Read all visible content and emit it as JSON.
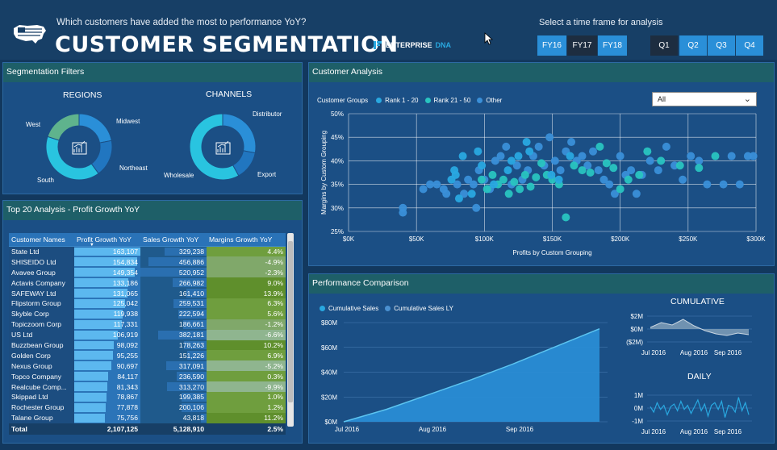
{
  "header": {
    "question": "Which customers have added the most to performance YoY?",
    "title": "CUSTOMER SEGMENTATION",
    "brand_part1": "ENTERPRISE",
    "brand_part2": "DNA",
    "timeframe_label": "Select a time frame for analysis",
    "fiscal_years": [
      {
        "label": "FY16",
        "selected": false
      },
      {
        "label": "FY17",
        "selected": true
      },
      {
        "label": "FY18",
        "selected": false
      }
    ],
    "quarters": [
      {
        "label": "Q1",
        "selected": true
      },
      {
        "label": "Q2",
        "selected": false
      },
      {
        "label": "Q3",
        "selected": false
      },
      {
        "label": "Q4",
        "selected": false
      }
    ]
  },
  "colors": {
    "dark_teal": "#1e5f68",
    "cyan": "#29c4e0",
    "mid_blue": "#2a8fd8",
    "green": "#5fb38d",
    "light_blue": "#48a6e6"
  },
  "segmentation": {
    "title": "Segmentation Filters",
    "regions": {
      "title": "REGIONS",
      "labels": [
        "Midwest",
        "Northeast",
        "South",
        "West"
      ],
      "values": [
        0.22,
        0.18,
        0.4,
        0.2
      ]
    },
    "channels": {
      "title": "CHANNELS",
      "labels": [
        "Distributor",
        "Export",
        "Wholesale"
      ],
      "values": [
        0.28,
        0.14,
        0.58
      ]
    }
  },
  "top20": {
    "title": "Top 20 Analysis - Profit Growth YoY",
    "columns": [
      "Customer Names",
      "Profit Growth YoY",
      "Sales Growth YoY",
      "Margins Growth YoY"
    ],
    "rows": [
      [
        "State Ltd",
        "163,107",
        "329,238",
        "4.4%"
      ],
      [
        "SHISEIDO Ltd",
        "154,834",
        "456,886",
        "-4.9%"
      ],
      [
        "Avavee Group",
        "149,354",
        "520,952",
        "-2.3%"
      ],
      [
        "Actavis Company",
        "133,186",
        "266,982",
        "9.0%"
      ],
      [
        "SAFEWAY Ltd",
        "131,065",
        "161,410",
        "13.9%"
      ],
      [
        "Flipstorm Group",
        "125,042",
        "259,531",
        "6.3%"
      ],
      [
        "Skyble Corp",
        "119,938",
        "222,594",
        "5.6%"
      ],
      [
        "Topiczoom Corp",
        "117,331",
        "186,661",
        "-1.2%"
      ],
      [
        "US Ltd",
        "106,919",
        "382,181",
        "-6.6%"
      ],
      [
        "Buzzbean Group",
        "98,092",
        "178,263",
        "10.2%"
      ],
      [
        "Golden Corp",
        "95,255",
        "151,226",
        "6.9%"
      ],
      [
        "Nexus Group",
        "90,697",
        "317,091",
        "-5.2%"
      ],
      [
        "Topco Company",
        "84,117",
        "236,590",
        "0.3%"
      ],
      [
        "Realcube Comp...",
        "81,343",
        "313,270",
        "-9.9%"
      ],
      [
        "Skippad Ltd",
        "78,867",
        "199,385",
        "1.0%"
      ],
      [
        "Rochester Group",
        "77,878",
        "200,106",
        "1.2%"
      ],
      [
        "Talane Group",
        "75,756",
        "43,818",
        "11.2%"
      ]
    ],
    "total": [
      "Total",
      "2,107,125",
      "5,128,910",
      "2.5%"
    ]
  },
  "customer_analysis": {
    "title": "Customer Analysis",
    "legend_title": "Customer Groups",
    "legend": [
      {
        "label": "Rank 1 - 20",
        "color": "#29a8e0"
      },
      {
        "label": "Rank 21 - 50",
        "color": "#29c4c0"
      },
      {
        "label": "Other",
        "color": "#3a8fd8"
      }
    ],
    "dropdown": "All"
  },
  "performance": {
    "title": "Performance Comparison",
    "legend": [
      {
        "label": "Cumulative Sales",
        "color": "#29a8e0"
      },
      {
        "label": "Cumulative Sales LY",
        "color": "#4a90d0"
      }
    ],
    "cumulative_title": "CUMULATIVE",
    "daily_title": "DAILY"
  },
  "chart_data": [
    {
      "type": "pie",
      "title": "REGIONS",
      "categories": [
        "Midwest",
        "Northeast",
        "South",
        "West"
      ],
      "values": [
        22,
        18,
        40,
        20
      ]
    },
    {
      "type": "pie",
      "title": "CHANNELS",
      "categories": [
        "Distributor",
        "Export",
        "Wholesale"
      ],
      "values": [
        28,
        14,
        58
      ]
    },
    {
      "type": "scatter",
      "xlabel": "Profits by Custom Grouping",
      "ylabel": "Margins by Custom Grouping",
      "xlim": [
        0,
        300000
      ],
      "ylim": [
        0.25,
        0.5
      ],
      "xticks": [
        "$0K",
        "$50K",
        "$100K",
        "$150K",
        "$200K",
        "$250K",
        "$300K"
      ],
      "yticks": [
        "25%",
        "30%",
        "35%",
        "40%",
        "45%",
        "50%"
      ],
      "series": [
        {
          "name": "Rank 1 - 20",
          "points": [
            [
              163107,
              0.41
            ],
            [
              154834,
              0.36
            ],
            [
              149354,
              0.37
            ],
            [
              133186,
              0.42
            ],
            [
              131065,
              0.44
            ],
            [
              125042,
              0.41
            ],
            [
              119938,
              0.4
            ],
            [
              117331,
              0.38
            ],
            [
              106919,
              0.35
            ],
            [
              98092,
              0.39
            ],
            [
              95255,
              0.42
            ],
            [
              90697,
              0.33
            ],
            [
              84117,
              0.41
            ],
            [
              81343,
              0.32
            ],
            [
              78867,
              0.37
            ],
            [
              77878,
              0.38
            ],
            [
              75756,
              0.36
            ]
          ]
        },
        {
          "name": "Rank 21 - 50",
          "points": [
            [
              270000,
              0.41
            ],
            [
              258000,
              0.385
            ],
            [
              244000,
              0.39
            ],
            [
              230000,
              0.4
            ],
            [
              220000,
              0.42
            ],
            [
              214000,
              0.37
            ],
            [
              206000,
              0.36
            ],
            [
              200000,
              0.34
            ],
            [
              195000,
              0.385
            ],
            [
              190000,
              0.395
            ],
            [
              185000,
              0.43
            ],
            [
              178000,
              0.375
            ],
            [
              172000,
              0.38
            ],
            [
              166000,
              0.39
            ],
            [
              160000,
              0.28
            ],
            [
              155000,
              0.35
            ],
            [
              150000,
              0.36
            ],
            [
              146000,
              0.37
            ],
            [
              142000,
              0.395
            ],
            [
              138000,
              0.365
            ],
            [
              134000,
              0.345
            ],
            [
              130000,
              0.37
            ],
            [
              126000,
              0.34
            ],
            [
              122000,
              0.355
            ],
            [
              118000,
              0.33
            ],
            [
              114000,
              0.36
            ],
            [
              110000,
              0.35
            ],
            [
              106000,
              0.37
            ],
            [
              102000,
              0.34
            ],
            [
              98000,
              0.36
            ]
          ]
        },
        {
          "name": "Other",
          "points": [
            [
              40000,
              0.29
            ],
            [
              40000,
              0.3
            ],
            [
              55000,
              0.34
            ],
            [
              60000,
              0.35
            ],
            [
              65000,
              0.35
            ],
            [
              70000,
              0.34
            ],
            [
              72000,
              0.33
            ],
            [
              80000,
              0.35
            ],
            [
              85000,
              0.33
            ],
            [
              88000,
              0.36
            ],
            [
              92000,
              0.35
            ],
            [
              94000,
              0.3
            ],
            [
              96000,
              0.38
            ],
            [
              100000,
              0.36
            ],
            [
              104000,
              0.34
            ],
            [
              108000,
              0.4
            ],
            [
              112000,
              0.41
            ],
            [
              116000,
              0.43
            ],
            [
              120000,
              0.35
            ],
            [
              124000,
              0.39
            ],
            [
              128000,
              0.36
            ],
            [
              132000,
              0.38
            ],
            [
              136000,
              0.41
            ],
            [
              140000,
              0.43
            ],
            [
              144000,
              0.39
            ],
            [
              148000,
              0.45
            ],
            [
              152000,
              0.4
            ],
            [
              156000,
              0.38
            ],
            [
              160000,
              0.42
            ],
            [
              164000,
              0.44
            ],
            [
              168000,
              0.4
            ],
            [
              172000,
              0.41
            ],
            [
              176000,
              0.39
            ],
            [
              180000,
              0.42
            ],
            [
              184000,
              0.38
            ],
            [
              188000,
              0.36
            ],
            [
              192000,
              0.35
            ],
            [
              196000,
              0.33
            ],
            [
              200000,
              0.41
            ],
            [
              204000,
              0.37
            ],
            [
              208000,
              0.38
            ],
            [
              212000,
              0.33
            ],
            [
              216000,
              0.37
            ],
            [
              222000,
              0.4
            ],
            [
              228000,
              0.38
            ],
            [
              234000,
              0.43
            ],
            [
              240000,
              0.39
            ],
            [
              246000,
              0.36
            ],
            [
              252000,
              0.41
            ],
            [
              258000,
              0.4
            ],
            [
              264000,
              0.35
            ],
            [
              276000,
              0.35
            ],
            [
              282000,
              0.41
            ],
            [
              288000,
              0.35
            ],
            [
              294000,
              0.41
            ],
            [
              298000,
              0.41
            ]
          ]
        }
      ]
    },
    {
      "type": "area",
      "title": "Performance Comparison",
      "xticks": [
        "Jul 2016",
        "Aug 2016",
        "Sep 2016"
      ],
      "yticks": [
        "$0M",
        "$20M",
        "$40M",
        "$60M",
        "$80M"
      ],
      "ylim": [
        0,
        80
      ],
      "x": [
        "2016-07-01",
        "2016-07-15",
        "2016-08-01",
        "2016-08-15",
        "2016-09-01",
        "2016-09-15",
        "2016-09-30"
      ],
      "series": [
        {
          "name": "Cumulative Sales",
          "values": [
            0,
            10,
            22,
            34,
            47,
            61,
            75
          ]
        }
      ]
    },
    {
      "type": "area",
      "title": "CUMULATIVE",
      "xticks": [
        "Jul 2016",
        "Aug 2016",
        "Sep 2016"
      ],
      "yticks": [
        "($2M)",
        "$0M",
        "$2M"
      ],
      "ylim": [
        -2,
        2
      ],
      "x": [
        "2016-07-01",
        "2016-07-10",
        "2016-07-20",
        "2016-08-01",
        "2016-08-10",
        "2016-08-20",
        "2016-09-01",
        "2016-09-10",
        "2016-09-20",
        "2016-09-30"
      ],
      "series": [
        {
          "values": [
            0.2,
            0.8,
            0.5,
            1.2,
            0.4,
            -0.2,
            -0.6,
            -0.8,
            -0.5,
            -0.7
          ]
        }
      ]
    },
    {
      "type": "line",
      "title": "DAILY",
      "xticks": [
        "Jul 2016",
        "Aug 2016",
        "Sep 2016"
      ],
      "yticks": [
        "-1M",
        "0M",
        "1M"
      ],
      "ylim": [
        -1.2,
        1.2
      ],
      "series": [
        {
          "values": [
            0.1,
            -0.3,
            0.4,
            -0.1,
            0.2,
            -0.5,
            0.1,
            0.3,
            -0.2,
            0.5,
            -0.1,
            0.2,
            -0.4,
            0.1,
            0.6,
            -0.2,
            0.3,
            -0.6,
            0.2,
            0.4,
            -0.1,
            0.5,
            -0.7,
            0.2,
            0.1,
            -0.3,
            0.8,
            -0.2,
            0.4,
            -0.5
          ]
        }
      ]
    }
  ]
}
